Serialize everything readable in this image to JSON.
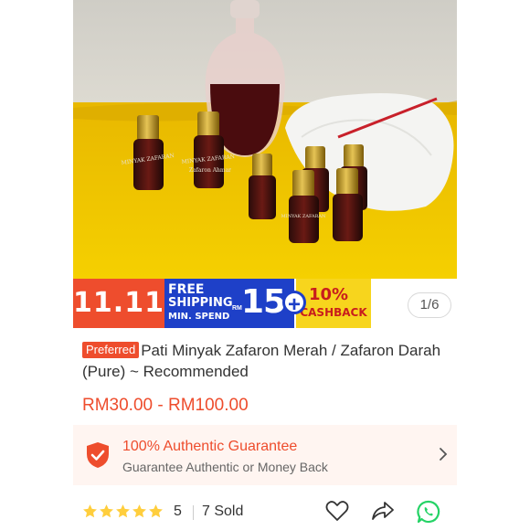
{
  "promo": {
    "date_label": "11.11",
    "free_label": "FREE",
    "shipping_label": "SHIPPING",
    "min_spend_label": "MIN. SPEND",
    "currency_label": "RM",
    "amount": "15",
    "plus": "+",
    "cashback_pct": "10%",
    "cashback_label": "CASHBACK"
  },
  "gallery": {
    "counter": "1/6"
  },
  "product": {
    "badge": "Preferred",
    "title": "Pati Minyak Zafaron Merah / Zafaron Darah (Pure) ~ Recommended",
    "price": "RM30.00 - RM100.00",
    "bottle_label_1": "MINYAK ZAFARAN",
    "bottle_label_2": "Zafaron Ahmar"
  },
  "guarantee": {
    "title": "100% Authentic Guarantee",
    "subtitle": "Guarantee Authentic or Money Back"
  },
  "stats": {
    "rating": "5",
    "stars": 5,
    "sold": "7 Sold"
  },
  "actions": {
    "like_icon": "heart-icon",
    "share_icon": "share-icon",
    "whatsapp_icon": "whatsapp-icon"
  },
  "colors": {
    "brand": "#ee4d2d",
    "star": "#ffce3d",
    "whatsapp": "#25d366",
    "promo_blue": "#1e40c8",
    "promo_yellow": "#f7d51d"
  }
}
